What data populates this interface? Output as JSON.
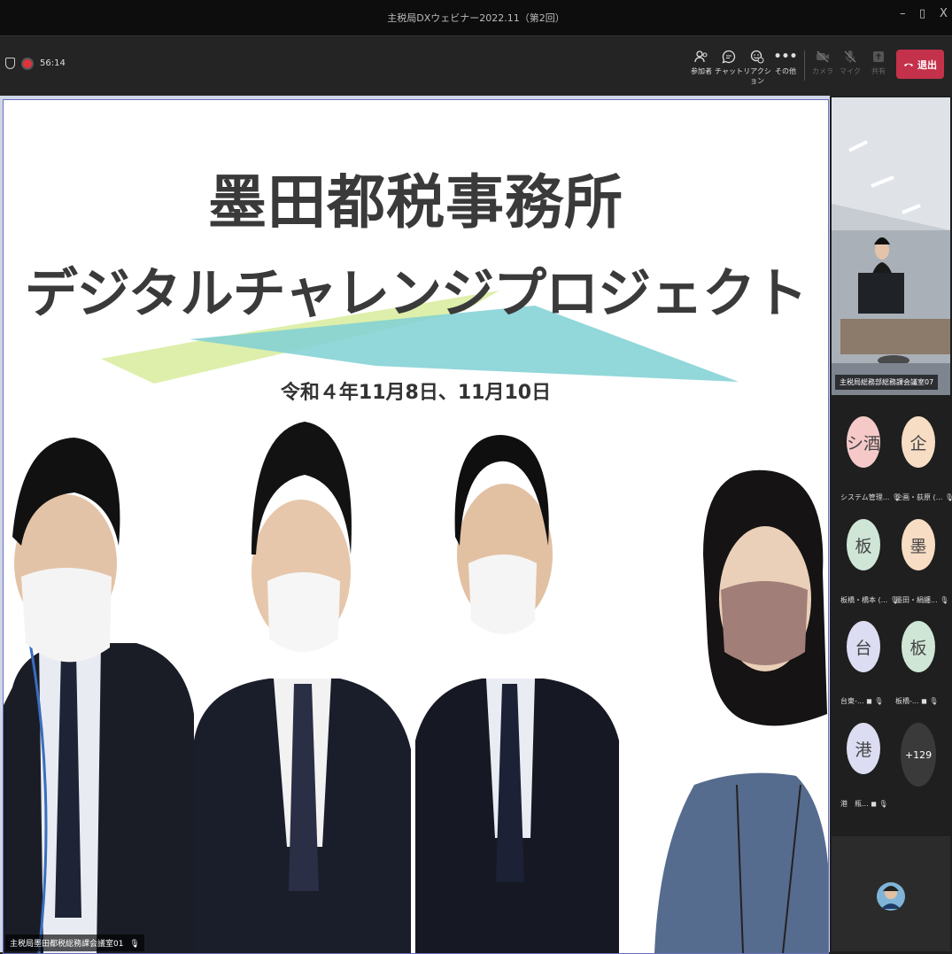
{
  "window": {
    "title": "主税局DXウェビナー2022.11（第2回）",
    "minimize": "–",
    "restore": "▯",
    "close": "X"
  },
  "toolbar": {
    "timer": "56:14",
    "buttons": [
      {
        "label": "参加者",
        "icon": "people-icon"
      },
      {
        "label": "チャット",
        "icon": "chat-icon"
      },
      {
        "label": "リアクション",
        "icon": "reaction-icon"
      },
      {
        "label": "その他",
        "icon": "more-icon"
      },
      {
        "label": "カメラ",
        "icon": "camera-off-icon"
      },
      {
        "label": "マイク",
        "icon": "mic-off-icon"
      },
      {
        "label": "共有",
        "icon": "share-icon"
      }
    ],
    "leave_label": "退出"
  },
  "slide": {
    "title_line1": "墨田都税事務所",
    "title_line2": "デジタルチャレンジプロジェクト",
    "date": "令和４年11月8日、11月10日"
  },
  "main_camera_label": "主税局墨田都税総務課会議室01",
  "side_camera_label": "主税局総務部総務課会議室07",
  "participants": [
    {
      "initials": "シ酒",
      "name": "システム管理...",
      "color": "#f6c9c9"
    },
    {
      "initials": "企",
      "name": "企画・荻原 (...",
      "color": "#f7ddc4"
    },
    {
      "initials": "板",
      "name": "板橋・橋本 (...",
      "color": "#cfe6d6"
    },
    {
      "initials": "墨",
      "name": "墨田・絹纏...",
      "color": "#f7ddc4"
    },
    {
      "initials": "台",
      "name": "台東-...",
      "color": "#dcdcf2"
    },
    {
      "initials": "板",
      "name": "板橋-...",
      "color": "#cfe6d6"
    },
    {
      "initials": "港",
      "name": "港　瓶...",
      "color": "#dcdcf2"
    }
  ],
  "more_count": "+129"
}
